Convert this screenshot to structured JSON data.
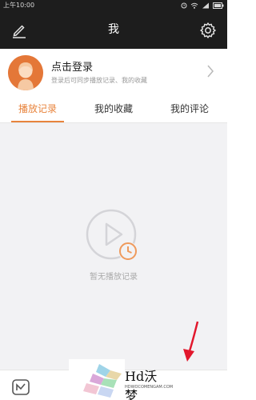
{
  "status_bar": {
    "time": "上午10:00"
  },
  "header": {
    "title": "我"
  },
  "login": {
    "name": "点击登录",
    "hint": "登录后可同步播放记录、我的收藏"
  },
  "tabs": [
    {
      "label": "播放记录",
      "active": true
    },
    {
      "label": "我的收藏",
      "active": false
    },
    {
      "label": "我的评论",
      "active": false
    }
  ],
  "empty_state": {
    "text": "暂无播放记录"
  },
  "watermark": {
    "text": "Hd沃梦",
    "sub": "HDWOCOMENGAM.COM"
  },
  "colors": {
    "accent": "#e8843d",
    "header_bg": "#1d1d1d",
    "content_bg": "#f2f2f4",
    "arrow": "#e2172c"
  },
  "icons": {
    "edit": "edit-icon",
    "settings": "gear-icon",
    "chevron": "chevron-right-icon",
    "empty": "play-history-icon",
    "app": "app-logo-icon"
  }
}
